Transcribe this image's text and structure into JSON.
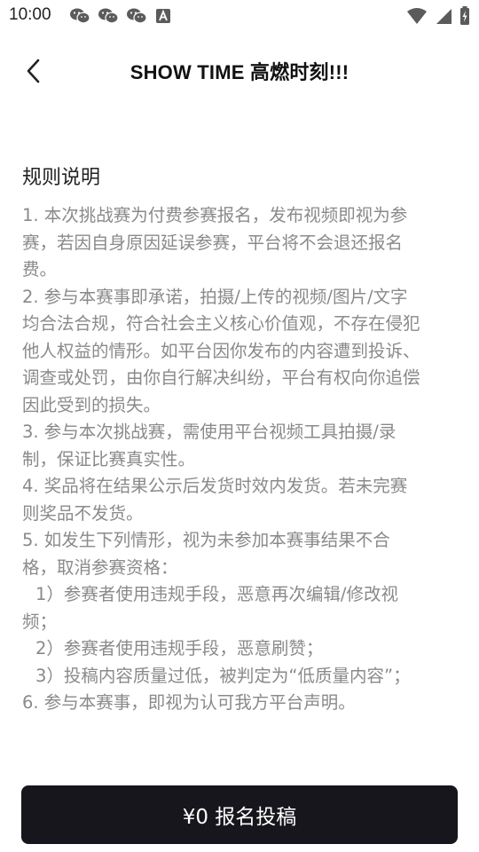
{
  "status_bar": {
    "time": "10:00",
    "notification_icons": [
      "wechat-icon",
      "wechat-icon",
      "wechat-icon",
      "accessibility-a-icon"
    ],
    "system_icons": [
      "wifi-icon",
      "signal-icon",
      "battery-charging-icon"
    ]
  },
  "header": {
    "back_icon": "chevron-left-icon",
    "title": "SHOW TIME 高燃时刻!!!"
  },
  "rules": {
    "title": "规则说明",
    "lines": [
      "1. 本次挑战赛为付费参赛报名，发布视频即视为参",
      "赛，若因自身原因延误参赛，平台将不会退还报名",
      "费。",
      "2. 参与本赛事即承诺，拍摄/上传的视频/图片/文字",
      "均合法合规，符合社会主义核心价值观，不存在侵犯",
      "他人权益的情形。如平台因你发布的内容遭到投诉、",
      "调查或处罚，由你自行解决纠纷，平台有权向你追偿",
      "因此受到的损失。",
      "3. 参与本次挑战赛，需使用平台视频工具拍摄/录",
      "制，保证比赛真实性。",
      "4. 奖品将在结果公示后发货时效内发货。若未完赛",
      "则奖品不发货。",
      "5. 如发生下列情形，视为未参加本赛事结果不合",
      "格，取消参赛资格：",
      "1）参赛者使用违规手段，恶意再次编辑/修改视",
      "频；",
      "2）参赛者使用违规手段，恶意刷赞；",
      "3）投稿内容质量过低，被判定为“低质量内容”；",
      "6. 参与本赛事，即视为认可我方平台声明。"
    ]
  },
  "footer": {
    "submit_label": "¥0 报名投稿",
    "button_color": "#16161c"
  }
}
